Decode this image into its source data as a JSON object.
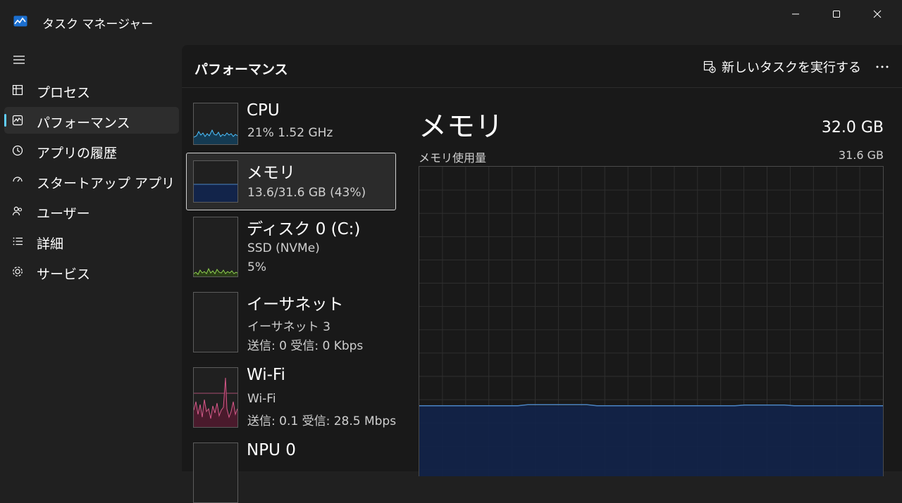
{
  "window": {
    "title": "タスク マネージャー"
  },
  "nav": {
    "items": [
      {
        "label": "プロセス",
        "icon": "processes-icon",
        "active": false
      },
      {
        "label": "パフォーマンス",
        "icon": "performance-icon",
        "active": true
      },
      {
        "label": "アプリの履歴",
        "icon": "history-icon",
        "active": false
      },
      {
        "label": "スタートアップ アプリ",
        "icon": "startup-icon",
        "active": false
      },
      {
        "label": "ユーザー",
        "icon": "users-icon",
        "active": false
      },
      {
        "label": "詳細",
        "icon": "details-icon",
        "active": false
      },
      {
        "label": "サービス",
        "icon": "services-icon",
        "active": false
      }
    ]
  },
  "header": {
    "title": "パフォーマンス",
    "new_task_label": "新しいタスクを実行する"
  },
  "perf_items": [
    {
      "name": "CPU",
      "lines": [
        "21% 1.52 GHz"
      ],
      "graph": "cpu",
      "color": "#4cc2ff",
      "selected": false
    },
    {
      "name": "メモリ",
      "lines": [
        "13.6/31.6 GB (43%)"
      ],
      "graph": "memory",
      "color": "#8ab4f8",
      "selected": true
    },
    {
      "name": "ディスク 0 (C:)",
      "lines": [
        "SSD (NVMe)",
        "5%"
      ],
      "graph": "disk",
      "color": "#8fd14f",
      "selected": false
    },
    {
      "name": "イーサネット",
      "lines": [
        "イーサネット 3",
        "送信: 0 受信: 0 Kbps"
      ],
      "graph": "ethernet",
      "color": "#c08f4f",
      "selected": false
    },
    {
      "name": "Wi-Fi",
      "lines": [
        "Wi-Fi",
        "送信: 0.1 受信: 28.5 Mbps"
      ],
      "graph": "wifi",
      "color": "#d65a8a",
      "selected": false
    },
    {
      "name": "NPU 0",
      "lines": [],
      "graph": "npu",
      "color": "#4cc2ff",
      "selected": false
    }
  ],
  "detail": {
    "title": "メモリ",
    "total": "32.0 GB",
    "graph_label": "メモリ使用量",
    "graph_max": "31.6 GB",
    "usage_fraction": 0.43
  },
  "colors": {
    "accent": "#60cdff",
    "memory_line": "#4a84c4",
    "memory_fill": "#12244a"
  }
}
